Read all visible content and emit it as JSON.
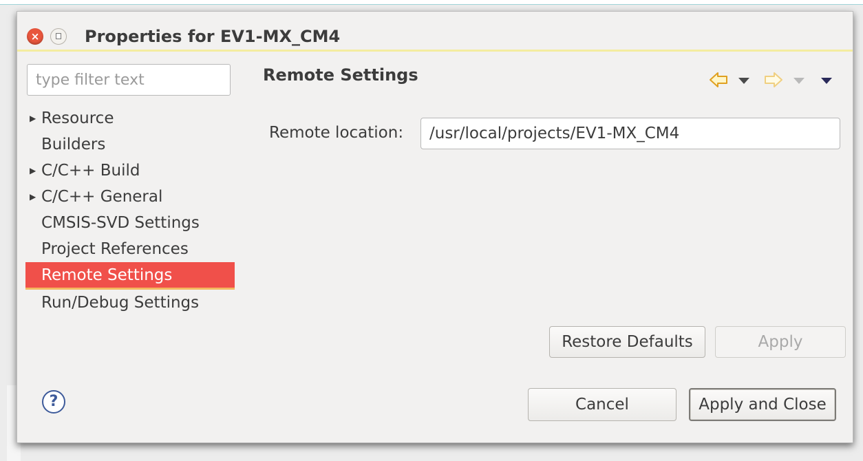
{
  "window": {
    "title": "Properties for EV1-MX_CM4"
  },
  "filter": {
    "placeholder": "type filter text",
    "value": ""
  },
  "tree": {
    "items": [
      {
        "label": "Resource",
        "expandable": true
      },
      {
        "label": "Builders",
        "expandable": false
      },
      {
        "label": "C/C++ Build",
        "expandable": true
      },
      {
        "label": "C/C++ General",
        "expandable": true
      },
      {
        "label": "CMSIS-SVD Settings",
        "expandable": false
      },
      {
        "label": "Project References",
        "expandable": false
      },
      {
        "label": "Remote Settings",
        "expandable": false,
        "selected": true
      },
      {
        "label": "Run/Debug Settings",
        "expandable": false
      }
    ]
  },
  "page": {
    "title": "Remote Settings",
    "remote_location_label": "Remote location:",
    "remote_location_value": "/usr/local/projects/EV1-MX_CM4"
  },
  "buttons": {
    "restore_defaults": "Restore Defaults",
    "apply": "Apply",
    "cancel": "Cancel",
    "apply_and_close": "Apply and Close"
  },
  "icons": {
    "close": "close-icon",
    "maximize": "maximize-icon",
    "back": "back-arrow-icon",
    "forward": "forward-arrow-icon",
    "menu": "view-menu-icon",
    "help": "help-icon"
  },
  "colors": {
    "selection": "#f0504a",
    "selection_underline": "#f4b860",
    "title_underline": "#f4eca0",
    "close_button": "#e8563d",
    "nav_arrow": "#f2b84b",
    "help": "#3d5a9a"
  }
}
